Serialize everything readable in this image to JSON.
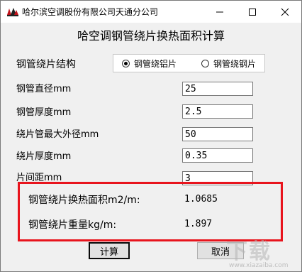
{
  "window": {
    "title": "哈尔滨空调股份有限公司天通分公司",
    "controls": [
      "minimize-icon",
      "maximize-icon",
      "close-icon"
    ]
  },
  "dialog": {
    "heading": "哈空调钢管绕片换热面积计算",
    "structure": {
      "label": "钢管绕片结构",
      "options": [
        {
          "label": "钢管绕铝片",
          "selected": true
        },
        {
          "label": "钢管绕钢片",
          "selected": false
        }
      ]
    },
    "fields": [
      {
        "label": "钢管直径mm",
        "value": "25"
      },
      {
        "label": "钢管厚度mm",
        "value": "2.5"
      },
      {
        "label": "绕片管最大外径mm",
        "value": "50"
      },
      {
        "label": "绕片厚度mm",
        "value": "0.35"
      },
      {
        "label": "片间距mm",
        "value": "3"
      }
    ],
    "results": {
      "highlight_color": "#e8141d",
      "area_label": "钢管绕片换热面积m2/m:",
      "area_value": "1.0685",
      "weight_label": "钢管绕片重量kg/m:",
      "weight_value": "1.897"
    },
    "buttons": {
      "calculate": "计算",
      "cancel": "取消"
    }
  },
  "watermark": {
    "text": "下载",
    "url": "www.xiazaiba.com"
  }
}
